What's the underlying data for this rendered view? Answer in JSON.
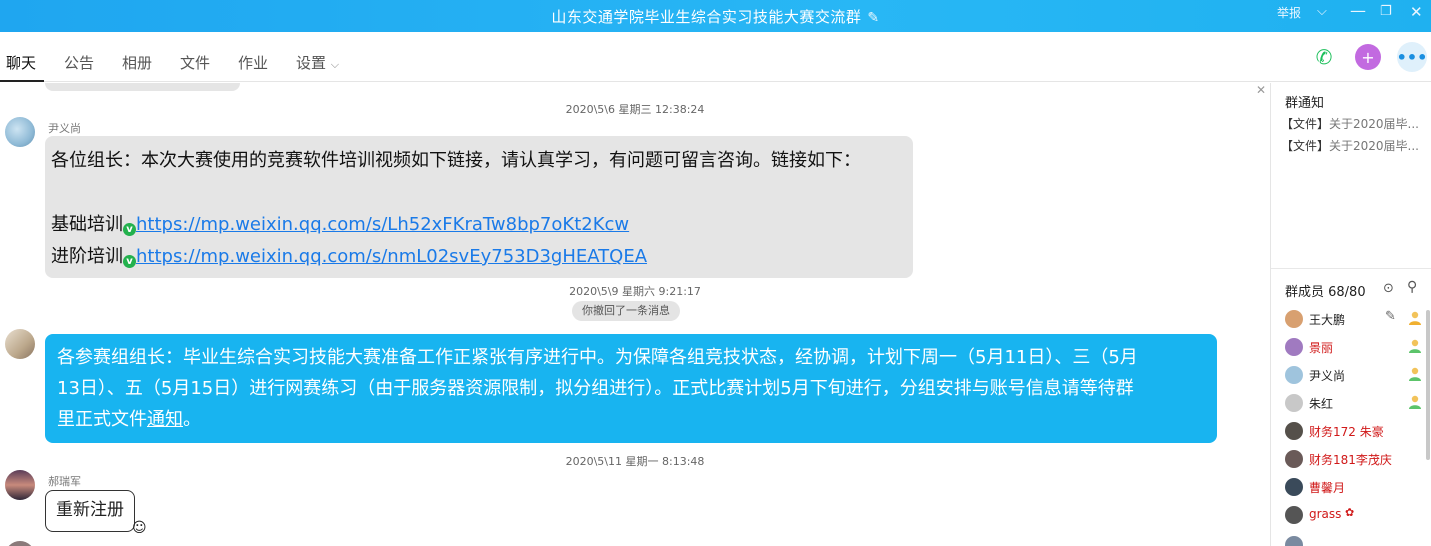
{
  "window": {
    "title": "山东交通学院毕业生综合实习技能大赛交流群",
    "report": "举报"
  },
  "tabs": [
    "聊天",
    "公告",
    "相册",
    "文件",
    "作业",
    "设置"
  ],
  "messages": {
    "ts1": "2020\\5\\6 星期三 12:38:24",
    "m1": {
      "sender": "尹义尚",
      "line1": "各位组长：本次大赛使用的竞赛软件培训视频如下链接，请认真学习，有问题可留言咨询。链接如下：",
      "line2_label": "基础培训",
      "line2_link": "https://mp.weixin.qq.com/s/Lh52xFKraTw8bp7oKt2Kcw",
      "line3_label": "进阶培训",
      "line3_link": "https://mp.weixin.qq.com/s/nmL02svEy753D3gHEATQEA"
    },
    "ts2": "2020\\5\\9 星期六 9:21:17",
    "recall": "你撤回了一条消息",
    "m2": {
      "l1": "各参赛组组长：毕业生综合实习技能大赛准备工作正紧张有序进行中。为保障各组竞技状态，经协调，计划下周一（5月11日）、三（5月",
      "l2": "13日）、五（5月15日）进行网赛练习（由于服务器资源限制，拟分组进行）。正式比赛计划5月下旬进行，分组安排与账号信息请等待群",
      "l3a": "里正式文件",
      "l3b": "通知",
      "l3c": "。"
    },
    "ts3": "2020\\5\\11 星期一 8:13:48",
    "m3": {
      "sender": "郝瑞军",
      "text": "重新注册"
    }
  },
  "side": {
    "notice_title": "群通知",
    "notices": [
      {
        "tag": "【文件】",
        "text": "关于2020届毕..."
      },
      {
        "tag": "【文件】",
        "text": "关于2020届毕..."
      }
    ],
    "members_title": "群成员 68/80",
    "members": [
      {
        "name": "王大鹏",
        "color": "#222",
        "av": "#d8a070"
      },
      {
        "name": "景丽",
        "color": "#d01818",
        "av": "#a07ac0"
      },
      {
        "name": "尹义尚",
        "color": "#222",
        "av": "#9fc4dd"
      },
      {
        "name": "朱红",
        "color": "#222",
        "av": "#c8c8c8"
      },
      {
        "name": "财务172 朱豪",
        "color": "#d01818",
        "av": "#55504a"
      },
      {
        "name": "财务181李茂庆",
        "color": "#d01818",
        "av": "#6a5a58"
      },
      {
        "name": "曹馨月",
        "color": "#d01818",
        "av": "#3a4a5a"
      },
      {
        "name": "grass",
        "color": "#d01818",
        "av": "#555"
      }
    ]
  }
}
